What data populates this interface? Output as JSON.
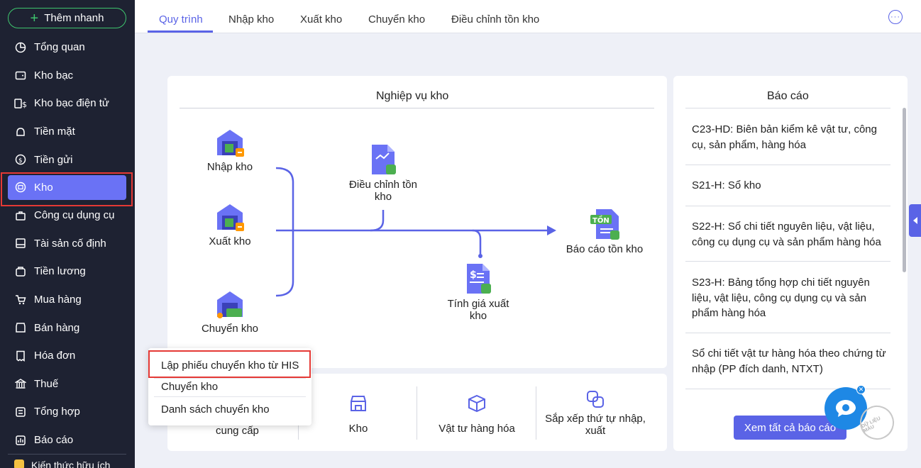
{
  "sidebar": {
    "quick_add": "Thêm nhanh",
    "items": [
      {
        "label": "Tổng quan",
        "icon": "pie-chart-icon"
      },
      {
        "label": "Kho bạc",
        "icon": "wallet-icon"
      },
      {
        "label": "Kho bạc điện tử",
        "icon": "dollar-card-icon"
      },
      {
        "label": "Tiền mặt",
        "icon": "cash-icon"
      },
      {
        "label": "Tiền gửi",
        "icon": "coin-icon"
      },
      {
        "label": "Kho",
        "icon": "warehouse-icon"
      },
      {
        "label": "Công cụ dụng cụ",
        "icon": "tools-icon"
      },
      {
        "label": "Tài sản cố định",
        "icon": "asset-icon"
      },
      {
        "label": "Tiền lương",
        "icon": "salary-icon"
      },
      {
        "label": "Mua hàng",
        "icon": "cart-icon"
      },
      {
        "label": "Bán hàng",
        "icon": "shop-icon"
      },
      {
        "label": "Hóa đơn",
        "icon": "invoice-icon"
      },
      {
        "label": "Thuế",
        "icon": "bank-icon"
      },
      {
        "label": "Tổng hợp",
        "icon": "summary-icon"
      },
      {
        "label": "Báo cáo",
        "icon": "report-icon"
      }
    ],
    "cut_item": "Kiến thức hữu ích",
    "active_index": 5
  },
  "tabs": [
    {
      "label": "Quy trình"
    },
    {
      "label": "Nhập kho"
    },
    {
      "label": "Xuất kho"
    },
    {
      "label": "Chuyển kho"
    },
    {
      "label": "Điều chỉnh tồn kho"
    }
  ],
  "flow": {
    "title": "Nghiệp vụ kho",
    "nodes": {
      "import": "Nhập kho",
      "export": "Xuất kho",
      "transfer": "Chuyển kho",
      "adjust_1": "Điều chỉnh tồn",
      "adjust_2": "kho",
      "report": "Báo cáo tồn kho",
      "price_1": "Tính giá xuất",
      "price_2": "kho",
      "ton_badge": "TỒN"
    }
  },
  "dropdown": {
    "items": [
      "Lập phiếu chuyển kho từ HIS",
      "Chuyển kho",
      "Danh sách chuyển kho"
    ]
  },
  "shortcuts": {
    "supplier_fragment": "cung cấp",
    "warehouse": "Kho",
    "materials": "Vật tư hàng hóa",
    "sort_1": "Sắp xếp thứ tự nhập,",
    "sort_2": "xuất"
  },
  "reports": {
    "title": "Báo cáo",
    "items": [
      "C23-HD: Biên bản kiểm kê vật tư, công cụ, sản phẩm, hàng hóa",
      "S21-H: Sổ kho",
      "S22-H: Sổ chi tiết nguyên liệu, vật liệu, công cụ dụng cụ và sản phẩm hàng hóa",
      "S23-H: Bảng tổng hợp chi tiết nguyên liệu, vật liệu, công cụ dụng cụ và sản phẩm hàng hóa",
      "Sổ chi tiết vật tư hàng hóa theo chứng từ nhập (PP đích danh, NTXT)"
    ],
    "view_all": "Xem tất cả báo cáo"
  },
  "watermark": "DỮ LIỆU MẪU",
  "colors": {
    "accent": "#5a63e6",
    "sidebar_bg": "#1e2232",
    "highlight": "#e53935",
    "green": "#3ec46d"
  }
}
